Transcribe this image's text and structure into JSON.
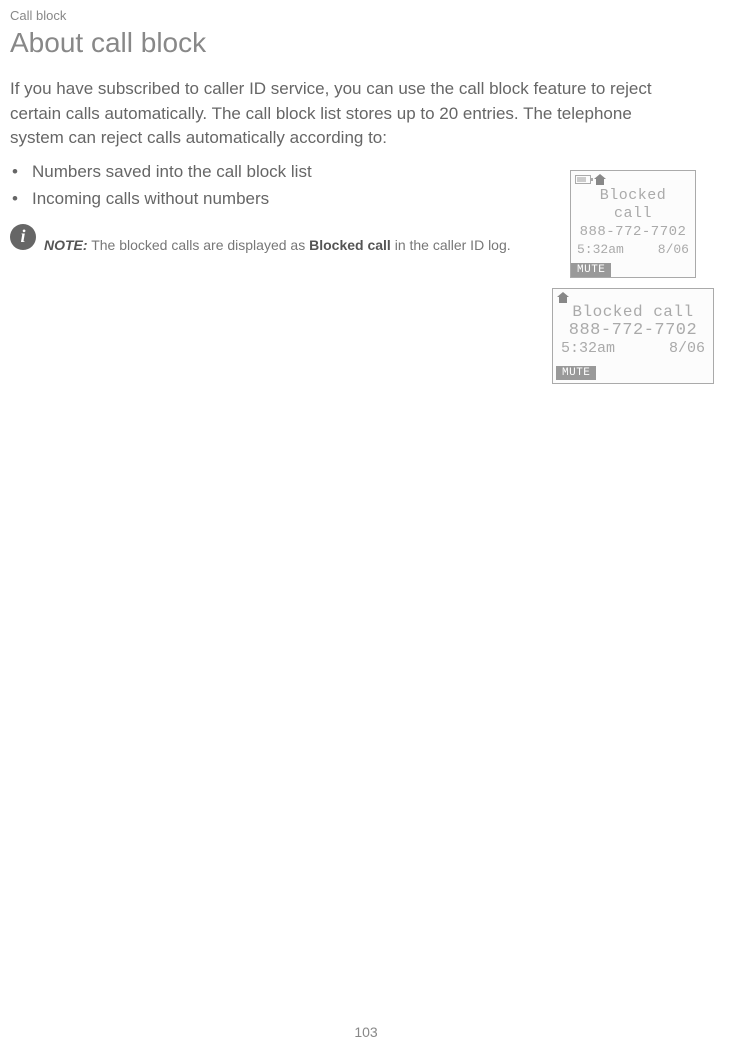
{
  "header": {
    "section": "Call block",
    "title": "About call block"
  },
  "intro": "If you have subscribed to caller ID service, you can use the call block feature to reject certain calls automatically. The call block list stores up to 20 entries. The telephone system can reject calls automatically according to:",
  "bullets": {
    "item0": "Numbers saved into the call block list",
    "item1": "Incoming calls without numbers"
  },
  "note": {
    "label": "NOTE:",
    "pre": " The blocked calls are displayed as ",
    "strong": "Blocked call",
    "post": " in the caller ID log."
  },
  "screen_small": {
    "line1": "Blocked",
    "line2": "call",
    "number": "888-772-7702",
    "time": "5:32am",
    "date": "8/06",
    "mute": "MUTE"
  },
  "screen_large": {
    "title": "Blocked call",
    "number": "888-772-7702",
    "time": "5:32am",
    "date": "8/06",
    "mute": "MUTE"
  },
  "page_number": "103"
}
